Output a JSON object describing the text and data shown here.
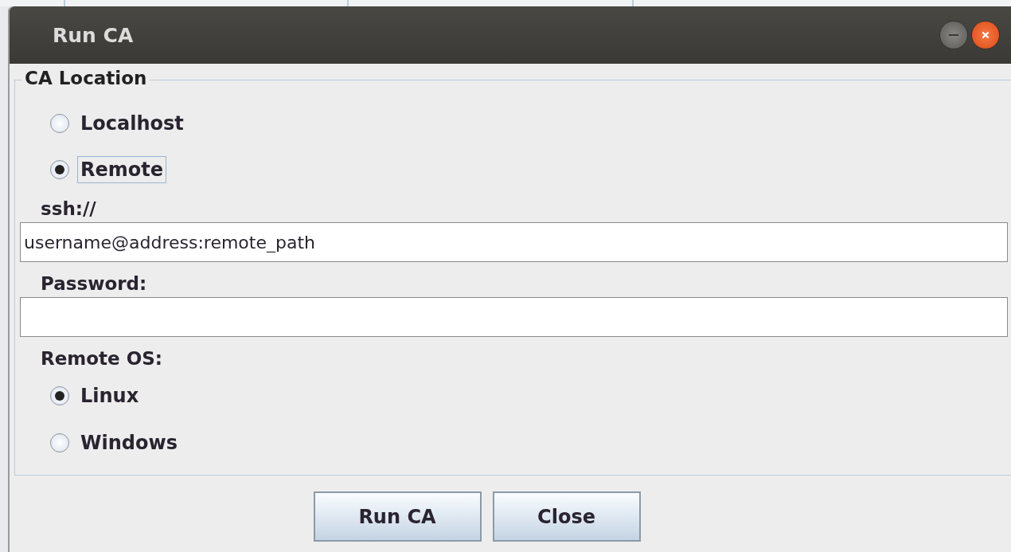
{
  "window": {
    "title": "Run CA"
  },
  "location": {
    "legend": "CA Location",
    "options": [
      {
        "label": "Localhost",
        "selected": false,
        "focused": false
      },
      {
        "label": "Remote",
        "selected": true,
        "focused": true
      }
    ],
    "ssh": {
      "label": "ssh://",
      "value": "username@address:remote_path"
    },
    "password": {
      "label": "Password:"
    },
    "remote_os": {
      "label": "Remote OS:",
      "options": [
        {
          "label": "Linux",
          "selected": true
        },
        {
          "label": "Windows",
          "selected": false
        }
      ]
    }
  },
  "buttons": [
    "Run CA",
    "Close"
  ]
}
